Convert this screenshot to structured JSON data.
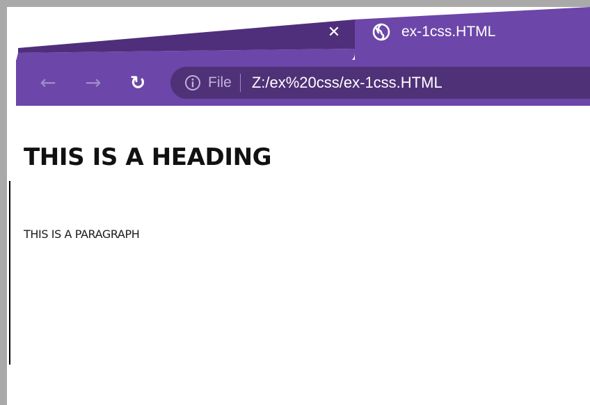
{
  "browser": {
    "tab": {
      "title": "ex-1css.HTML",
      "close_glyph": "✕",
      "favicon": "globe-icon"
    },
    "toolbar": {
      "back_glyph": "←",
      "forward_glyph": "→",
      "reload_glyph": "↻"
    },
    "address_bar": {
      "scheme_label": "File",
      "url": "Z:/ex%20css/ex-1css.HTML",
      "info_icon": "info-icon"
    },
    "colors": {
      "tab_active": "#6c46a8",
      "tab_inactive": "#4f2f7b",
      "toolbar": "#6c46a8",
      "omnibox": "#4f3178",
      "frame": "#a9a9a9"
    }
  },
  "page": {
    "heading": "THIS IS A HEADING",
    "paragraph": "THIS IS A PARAGRAPH"
  }
}
